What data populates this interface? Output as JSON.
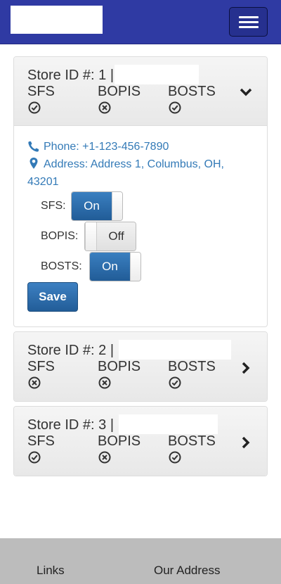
{
  "header": {
    "brand_logo": "",
    "menu_icon": "hamburger-icon"
  },
  "stores": [
    {
      "title": "Store ID #: 1 |",
      "expanded": true,
      "columns": [
        {
          "label": "SFS",
          "status": "check"
        },
        {
          "label": "BOPIS",
          "status": "cross"
        },
        {
          "label": "BOSTS",
          "status": "check"
        }
      ],
      "phone": "Phone: +1-123-456-7890",
      "address_line1": "Address: Address 1, Columbus, OH,",
      "address_line2": "43201",
      "toggles": [
        {
          "label": "SFS:",
          "state": "On"
        },
        {
          "label": "BOPIS:",
          "state": "Off"
        },
        {
          "label": "BOSTS:",
          "state": "On"
        }
      ],
      "save_label": "Save"
    },
    {
      "title": "Store ID #: 2 |",
      "expanded": false,
      "columns": [
        {
          "label": "SFS",
          "status": "cross"
        },
        {
          "label": "BOPIS",
          "status": "cross"
        },
        {
          "label": "BOSTS",
          "status": "check"
        }
      ]
    },
    {
      "title": "Store ID #: 3 |",
      "expanded": false,
      "columns": [
        {
          "label": "SFS",
          "status": "check"
        },
        {
          "label": "BOPIS",
          "status": "cross"
        },
        {
          "label": "BOSTS",
          "status": "check"
        }
      ]
    }
  ],
  "footer": {
    "links_label": "Links",
    "address_label": "Our Address"
  },
  "colors": {
    "navbar": "#2f3aa3",
    "accent": "#337ab7",
    "button": "#2a6aa8",
    "footer": "#bcbcbc"
  }
}
